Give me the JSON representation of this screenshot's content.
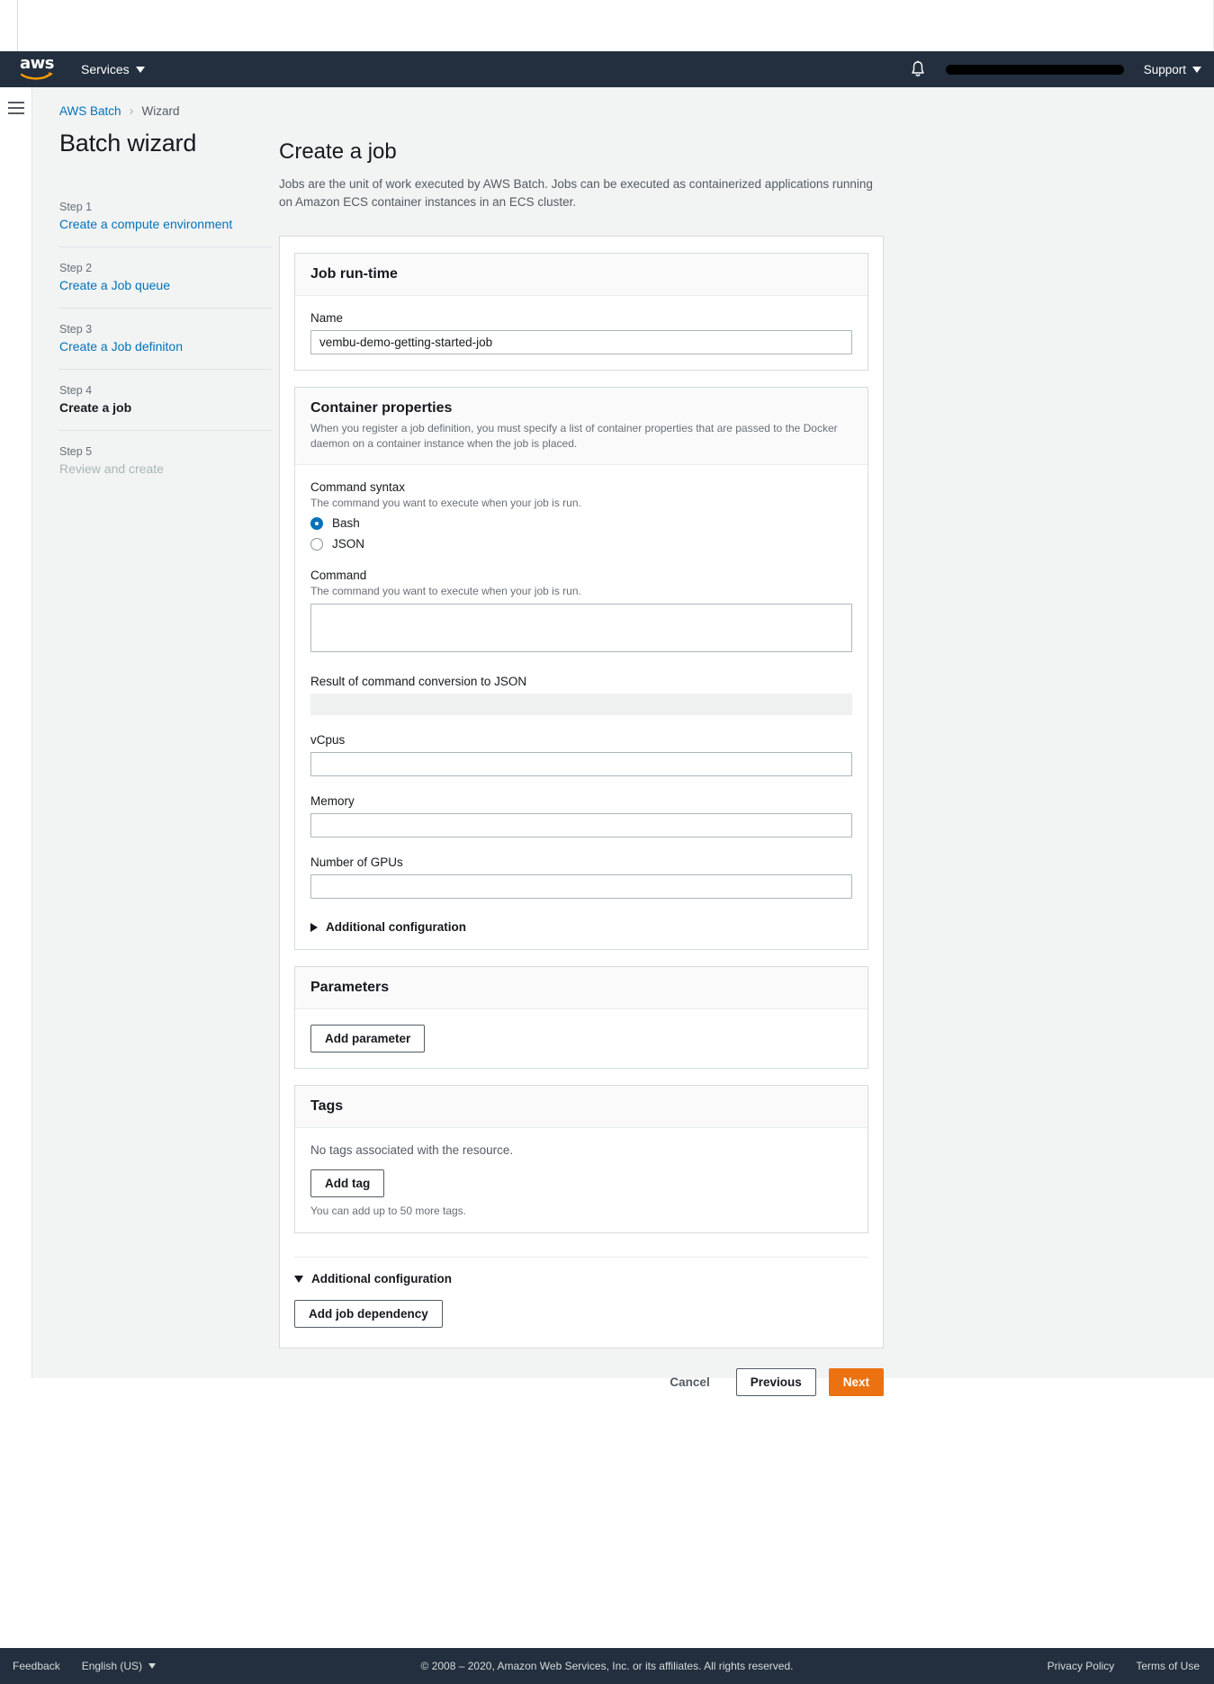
{
  "topnav": {
    "logo_text": "aws",
    "services_label": "Services",
    "support_label": "Support",
    "bell_icon": "bell-icon",
    "account_redacted": ""
  },
  "breadcrumb": {
    "root": "AWS Batch",
    "separator": "›",
    "current": "Wizard"
  },
  "wizard": {
    "title": "Batch wizard",
    "steps": [
      {
        "num": "Step 1",
        "label": "Create a compute environment",
        "state": "link"
      },
      {
        "num": "Step 2",
        "label": "Create a Job queue",
        "state": "link"
      },
      {
        "num": "Step 3",
        "label": "Create a Job definiton",
        "state": "link"
      },
      {
        "num": "Step 4",
        "label": "Create a job",
        "state": "active"
      },
      {
        "num": "Step 5",
        "label": "Review and create",
        "state": "disabled"
      }
    ]
  },
  "main": {
    "title": "Create a job",
    "description": "Jobs are the unit of work executed by AWS Batch. Jobs can be executed as containerized applications running on Amazon ECS container instances in an ECS cluster."
  },
  "job_runtime": {
    "title": "Job run-time",
    "name_label": "Name",
    "name_value": "vembu-demo-getting-started-job",
    "name_placeholder": ""
  },
  "container_properties": {
    "title": "Container properties",
    "description": "When you register a job definition, you must specify a list of container properties that are passed to the Docker daemon on a container instance when the job is placed.",
    "command_syntax_label": "Command syntax",
    "command_syntax_hint": "The command you want to execute when your job is run.",
    "syntax_options": [
      {
        "label": "Bash",
        "selected": true
      },
      {
        "label": "JSON",
        "selected": false
      }
    ],
    "command_label": "Command",
    "command_hint": "The command you want to execute when your job is run.",
    "command_value": "",
    "conversion_label": "Result of command conversion to JSON",
    "conversion_value": "",
    "vcpus_label": "vCpus",
    "vcpus_value": "",
    "memory_label": "Memory",
    "memory_value": "",
    "gpus_label": "Number of GPUs",
    "gpus_value": "",
    "additional_config_label": "Additional configuration"
  },
  "parameters": {
    "title": "Parameters",
    "add_button": "Add parameter"
  },
  "tags": {
    "title": "Tags",
    "empty_text": "No tags associated with the resource.",
    "add_button": "Add tag",
    "limit_note": "You can add up to 50 more tags."
  },
  "additional_configuration": {
    "label": "Additional configuration",
    "add_dependency_button": "Add job dependency"
  },
  "form_actions": {
    "cancel": "Cancel",
    "previous": "Previous",
    "next": "Next"
  },
  "bottom_bar": {
    "feedback": "Feedback",
    "language": "English (US)",
    "copyright": "© 2008 – 2020, Amazon Web Services, Inc. or its affiliates. All rights reserved.",
    "privacy": "Privacy Policy",
    "terms": "Terms of Use"
  },
  "colors": {
    "nav_bg": "#232f3e",
    "link": "#0073bb",
    "primary_button": "#ec7211",
    "page_bg": "#f2f3f3"
  }
}
